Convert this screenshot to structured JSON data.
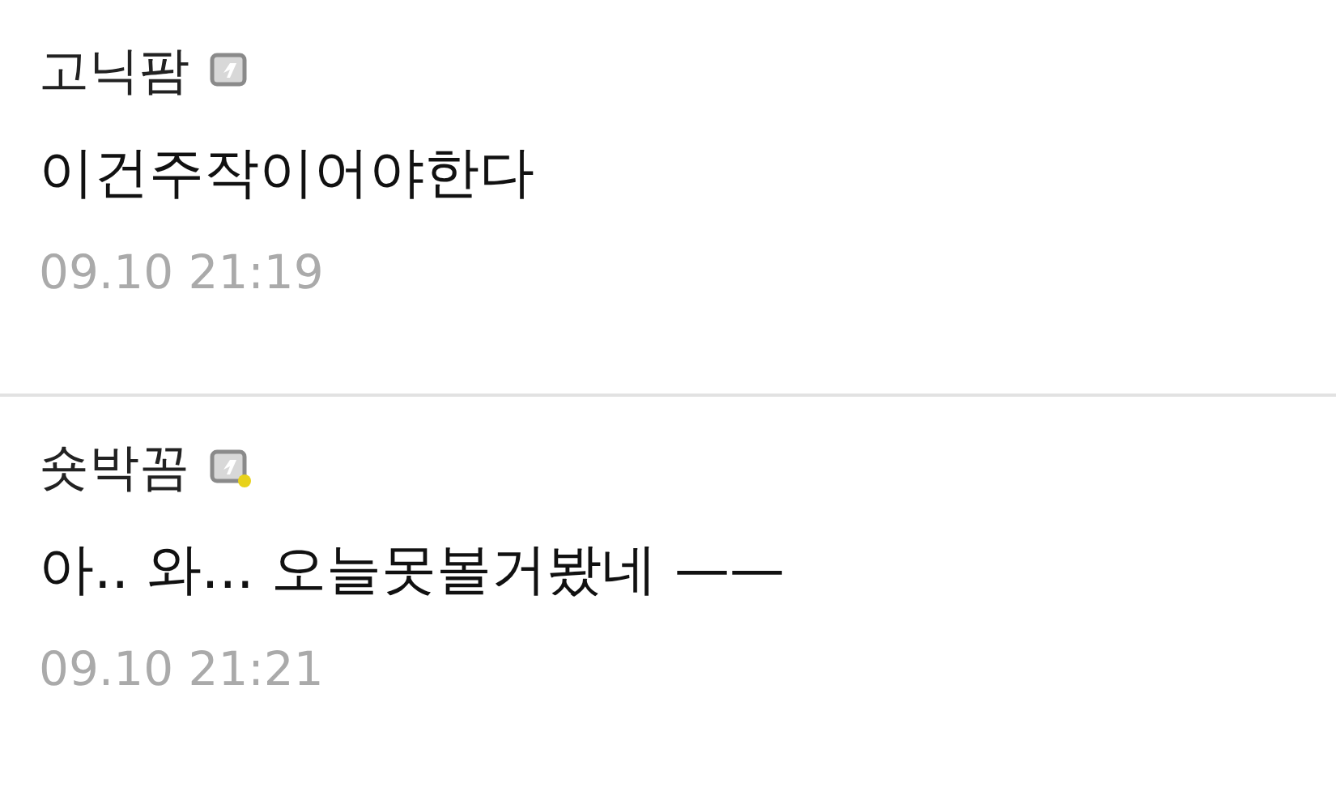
{
  "comments": [
    {
      "author": "고닉팜",
      "dot": false,
      "text": "이건주작이어야한다",
      "time": "09.10 21:19"
    },
    {
      "author": "숏박꼼",
      "dot": true,
      "text": "아.. 와... 오늘못볼거봤네 ——",
      "time": "09.10 21:21"
    }
  ]
}
